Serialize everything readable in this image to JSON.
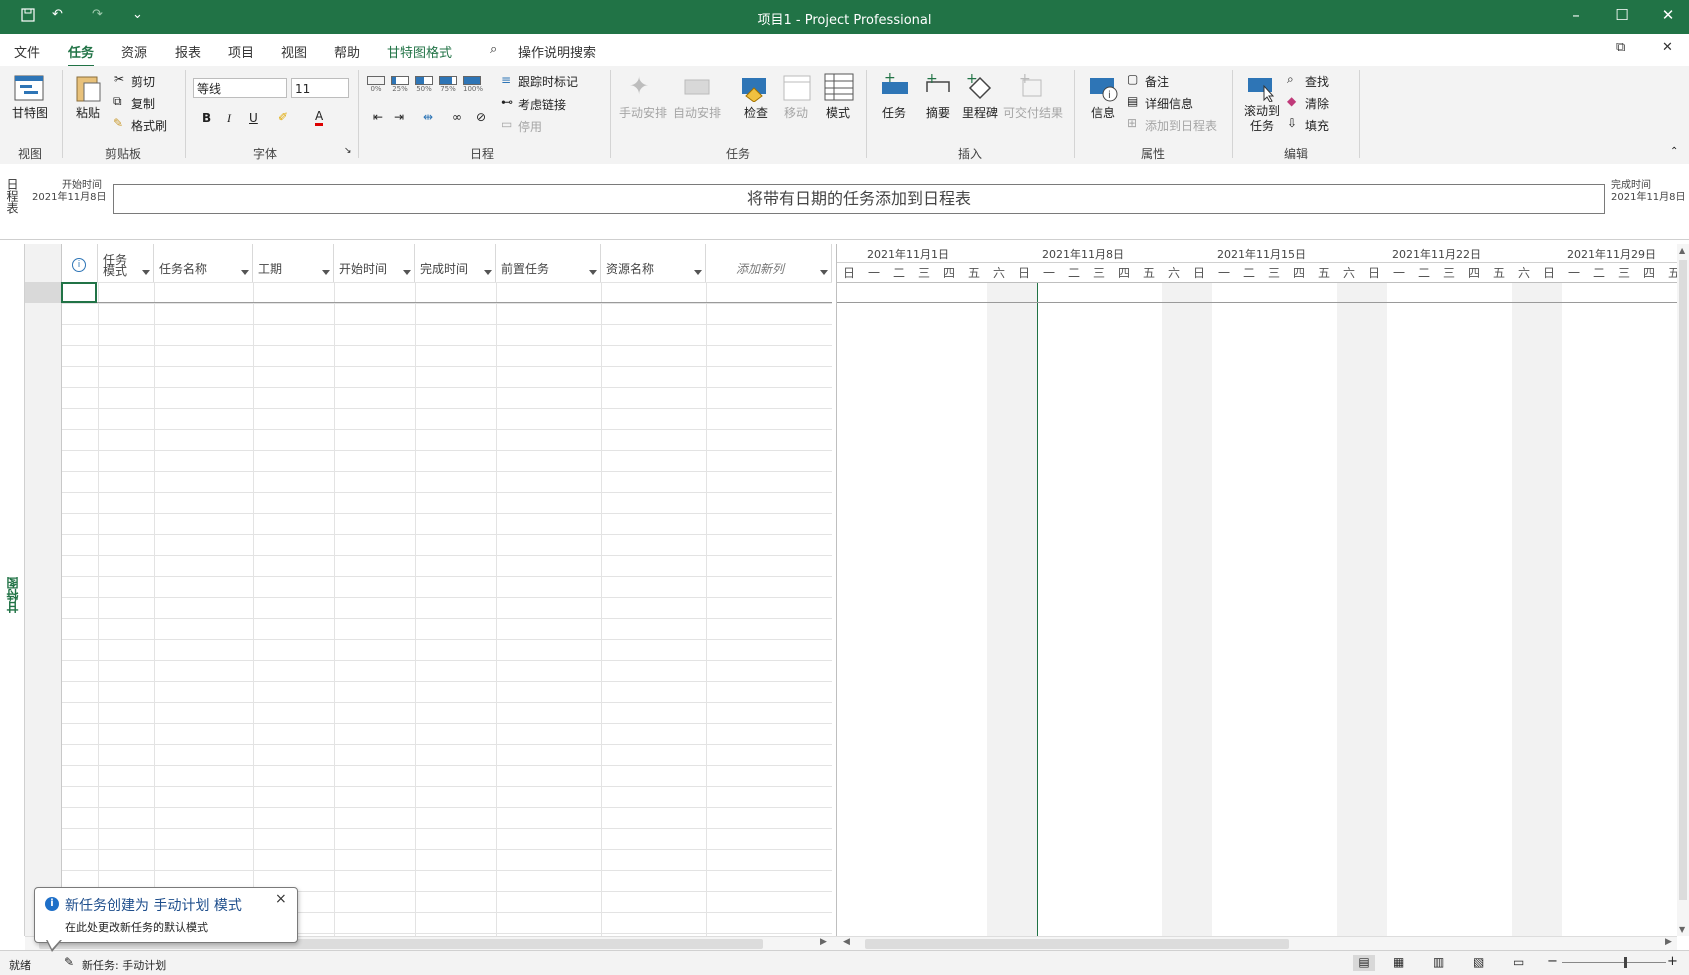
{
  "titlebar": {
    "title": "项目1  -  Project Professional",
    "customize_glyph": "⌄"
  },
  "menu": {
    "items": [
      "文件",
      "任务",
      "资源",
      "报表",
      "项目",
      "视图",
      "帮助"
    ],
    "context_tab": "甘特图格式",
    "search": "操作说明搜索"
  },
  "ribbon": {
    "groups": {
      "view": "视图",
      "clipboard": "剪贴板",
      "font": "字体",
      "schedule": "日程",
      "tasks": "任务",
      "insert": "插入",
      "properties": "属性",
      "editing": "编辑"
    },
    "view_btn": "甘特图",
    "paste": "粘贴",
    "cut": "剪切",
    "copy": "复制",
    "format_painter": "格式刷",
    "font_name": "等线",
    "font_size": "11",
    "bold": "B",
    "italic": "I",
    "underline": "U",
    "font_color": "A",
    "pct": [
      "0%",
      "25%",
      "50%",
      "75%",
      "100%"
    ],
    "mark_on_track": "跟踪时标记",
    "respect_links": "考虑链接",
    "inactivate": "停用",
    "manual": "手动安排",
    "auto": "自动安排",
    "inspect": "检查",
    "move": "移动",
    "mode": "模式",
    "task": "任务",
    "summary": "摘要",
    "milestone": "里程碑",
    "deliverable": "可交付结果",
    "info": "信息",
    "notes": "备注",
    "details": "详细信息",
    "add_to_timeline": "添加到日程表",
    "scroll_to_task_l1": "滚动到",
    "scroll_to_task_l2": "任务",
    "find": "查找",
    "clear": "清除",
    "fill": "填充"
  },
  "timeline": {
    "side_label": "日程表",
    "start_label": "开始时间",
    "start_date": "2021年11月8日",
    "finish_label": "完成时间",
    "finish_date": "2021年11月8日",
    "placeholder": "将带有日期的任务添加到日程表"
  },
  "side_label": "甘特图",
  "grid": {
    "columns": [
      "任务\n模式",
      "任务名称",
      "工期",
      "开始时间",
      "完成时间",
      "前置任务",
      "资源名称",
      "添加新列"
    ]
  },
  "chart": {
    "weeks": [
      "2021年11月1日",
      "2021年11月8日",
      "2021年11月15日",
      "2021年11月22日",
      "2021年11月29日"
    ],
    "days": [
      "日",
      "一",
      "二",
      "三",
      "四",
      "五",
      "六"
    ]
  },
  "notice": {
    "title": "新任务创建为 手动计划 模式",
    "sub": "在此处更改新任务的默认模式",
    "close": "×"
  },
  "status": {
    "ready": "就绪",
    "new_task": "新任务: 手动计划"
  },
  "colors": {
    "accent": "#217346",
    "info": "#1e6fc8"
  }
}
